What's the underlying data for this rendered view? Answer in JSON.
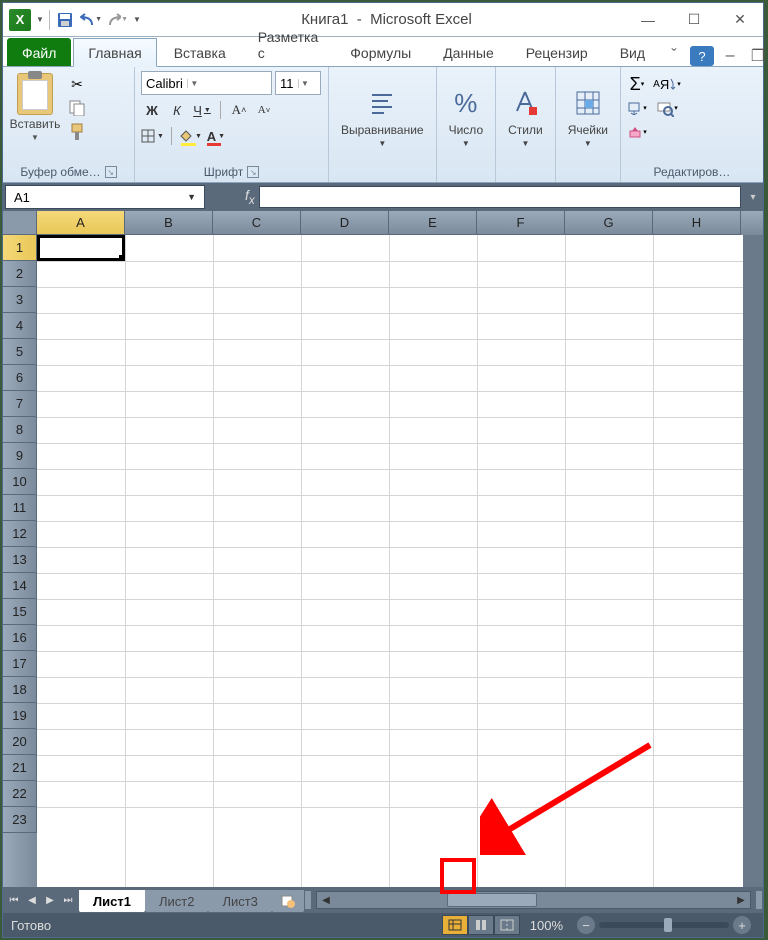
{
  "titlebar": {
    "document": "Книга1",
    "app": "Microsoft Excel"
  },
  "tabs": {
    "file": "Файл",
    "home": "Главная",
    "insert": "Вставка",
    "layout": "Разметка с",
    "formulas": "Формулы",
    "data": "Данные",
    "review": "Рецензир",
    "view": "Вид"
  },
  "groups": {
    "clipboard": "Буфер обме…",
    "font": "Шрифт",
    "alignment": "Выравнивание",
    "number": "Число",
    "styles": "Стили",
    "cells": "Ячейки",
    "editing": "Редактиров…"
  },
  "buttons": {
    "paste": "Вставить"
  },
  "font": {
    "name": "Calibri",
    "size": "11",
    "bold": "Ж",
    "italic": "К",
    "underline": "Ч"
  },
  "namebox": "A1",
  "columns": [
    "A",
    "B",
    "C",
    "D",
    "E",
    "F",
    "G",
    "H"
  ],
  "rows": [
    "1",
    "2",
    "3",
    "4",
    "5",
    "6",
    "7",
    "8",
    "9",
    "10",
    "11",
    "12",
    "13",
    "14",
    "15",
    "16",
    "17",
    "18",
    "19",
    "20",
    "21",
    "22",
    "23"
  ],
  "sheets": {
    "s1": "Лист1",
    "s2": "Лист2",
    "s3": "Лист3"
  },
  "status": "Готово",
  "zoom": "100%"
}
